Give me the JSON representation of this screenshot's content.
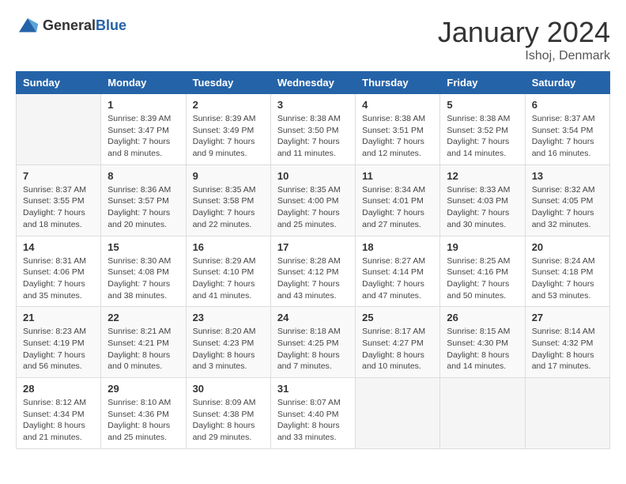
{
  "header": {
    "logo_general": "General",
    "logo_blue": "Blue",
    "month_title": "January 2024",
    "location": "Ishoj, Denmark"
  },
  "days_of_week": [
    "Sunday",
    "Monday",
    "Tuesday",
    "Wednesday",
    "Thursday",
    "Friday",
    "Saturday"
  ],
  "weeks": [
    [
      {
        "day": "",
        "sunrise": "",
        "sunset": "",
        "daylight": ""
      },
      {
        "day": "1",
        "sunrise": "Sunrise: 8:39 AM",
        "sunset": "Sunset: 3:47 PM",
        "daylight": "Daylight: 7 hours and 8 minutes."
      },
      {
        "day": "2",
        "sunrise": "Sunrise: 8:39 AM",
        "sunset": "Sunset: 3:49 PM",
        "daylight": "Daylight: 7 hours and 9 minutes."
      },
      {
        "day": "3",
        "sunrise": "Sunrise: 8:38 AM",
        "sunset": "Sunset: 3:50 PM",
        "daylight": "Daylight: 7 hours and 11 minutes."
      },
      {
        "day": "4",
        "sunrise": "Sunrise: 8:38 AM",
        "sunset": "Sunset: 3:51 PM",
        "daylight": "Daylight: 7 hours and 12 minutes."
      },
      {
        "day": "5",
        "sunrise": "Sunrise: 8:38 AM",
        "sunset": "Sunset: 3:52 PM",
        "daylight": "Daylight: 7 hours and 14 minutes."
      },
      {
        "day": "6",
        "sunrise": "Sunrise: 8:37 AM",
        "sunset": "Sunset: 3:54 PM",
        "daylight": "Daylight: 7 hours and 16 minutes."
      }
    ],
    [
      {
        "day": "7",
        "sunrise": "Sunrise: 8:37 AM",
        "sunset": "Sunset: 3:55 PM",
        "daylight": "Daylight: 7 hours and 18 minutes."
      },
      {
        "day": "8",
        "sunrise": "Sunrise: 8:36 AM",
        "sunset": "Sunset: 3:57 PM",
        "daylight": "Daylight: 7 hours and 20 minutes."
      },
      {
        "day": "9",
        "sunrise": "Sunrise: 8:35 AM",
        "sunset": "Sunset: 3:58 PM",
        "daylight": "Daylight: 7 hours and 22 minutes."
      },
      {
        "day": "10",
        "sunrise": "Sunrise: 8:35 AM",
        "sunset": "Sunset: 4:00 PM",
        "daylight": "Daylight: 7 hours and 25 minutes."
      },
      {
        "day": "11",
        "sunrise": "Sunrise: 8:34 AM",
        "sunset": "Sunset: 4:01 PM",
        "daylight": "Daylight: 7 hours and 27 minutes."
      },
      {
        "day": "12",
        "sunrise": "Sunrise: 8:33 AM",
        "sunset": "Sunset: 4:03 PM",
        "daylight": "Daylight: 7 hours and 30 minutes."
      },
      {
        "day": "13",
        "sunrise": "Sunrise: 8:32 AM",
        "sunset": "Sunset: 4:05 PM",
        "daylight": "Daylight: 7 hours and 32 minutes."
      }
    ],
    [
      {
        "day": "14",
        "sunrise": "Sunrise: 8:31 AM",
        "sunset": "Sunset: 4:06 PM",
        "daylight": "Daylight: 7 hours and 35 minutes."
      },
      {
        "day": "15",
        "sunrise": "Sunrise: 8:30 AM",
        "sunset": "Sunset: 4:08 PM",
        "daylight": "Daylight: 7 hours and 38 minutes."
      },
      {
        "day": "16",
        "sunrise": "Sunrise: 8:29 AM",
        "sunset": "Sunset: 4:10 PM",
        "daylight": "Daylight: 7 hours and 41 minutes."
      },
      {
        "day": "17",
        "sunrise": "Sunrise: 8:28 AM",
        "sunset": "Sunset: 4:12 PM",
        "daylight": "Daylight: 7 hours and 43 minutes."
      },
      {
        "day": "18",
        "sunrise": "Sunrise: 8:27 AM",
        "sunset": "Sunset: 4:14 PM",
        "daylight": "Daylight: 7 hours and 47 minutes."
      },
      {
        "day": "19",
        "sunrise": "Sunrise: 8:25 AM",
        "sunset": "Sunset: 4:16 PM",
        "daylight": "Daylight: 7 hours and 50 minutes."
      },
      {
        "day": "20",
        "sunrise": "Sunrise: 8:24 AM",
        "sunset": "Sunset: 4:18 PM",
        "daylight": "Daylight: 7 hours and 53 minutes."
      }
    ],
    [
      {
        "day": "21",
        "sunrise": "Sunrise: 8:23 AM",
        "sunset": "Sunset: 4:19 PM",
        "daylight": "Daylight: 7 hours and 56 minutes."
      },
      {
        "day": "22",
        "sunrise": "Sunrise: 8:21 AM",
        "sunset": "Sunset: 4:21 PM",
        "daylight": "Daylight: 8 hours and 0 minutes."
      },
      {
        "day": "23",
        "sunrise": "Sunrise: 8:20 AM",
        "sunset": "Sunset: 4:23 PM",
        "daylight": "Daylight: 8 hours and 3 minutes."
      },
      {
        "day": "24",
        "sunrise": "Sunrise: 8:18 AM",
        "sunset": "Sunset: 4:25 PM",
        "daylight": "Daylight: 8 hours and 7 minutes."
      },
      {
        "day": "25",
        "sunrise": "Sunrise: 8:17 AM",
        "sunset": "Sunset: 4:27 PM",
        "daylight": "Daylight: 8 hours and 10 minutes."
      },
      {
        "day": "26",
        "sunrise": "Sunrise: 8:15 AM",
        "sunset": "Sunset: 4:30 PM",
        "daylight": "Daylight: 8 hours and 14 minutes."
      },
      {
        "day": "27",
        "sunrise": "Sunrise: 8:14 AM",
        "sunset": "Sunset: 4:32 PM",
        "daylight": "Daylight: 8 hours and 17 minutes."
      }
    ],
    [
      {
        "day": "28",
        "sunrise": "Sunrise: 8:12 AM",
        "sunset": "Sunset: 4:34 PM",
        "daylight": "Daylight: 8 hours and 21 minutes."
      },
      {
        "day": "29",
        "sunrise": "Sunrise: 8:10 AM",
        "sunset": "Sunset: 4:36 PM",
        "daylight": "Daylight: 8 hours and 25 minutes."
      },
      {
        "day": "30",
        "sunrise": "Sunrise: 8:09 AM",
        "sunset": "Sunset: 4:38 PM",
        "daylight": "Daylight: 8 hours and 29 minutes."
      },
      {
        "day": "31",
        "sunrise": "Sunrise: 8:07 AM",
        "sunset": "Sunset: 4:40 PM",
        "daylight": "Daylight: 8 hours and 33 minutes."
      },
      {
        "day": "",
        "sunrise": "",
        "sunset": "",
        "daylight": ""
      },
      {
        "day": "",
        "sunrise": "",
        "sunset": "",
        "daylight": ""
      },
      {
        "day": "",
        "sunrise": "",
        "sunset": "",
        "daylight": ""
      }
    ]
  ]
}
